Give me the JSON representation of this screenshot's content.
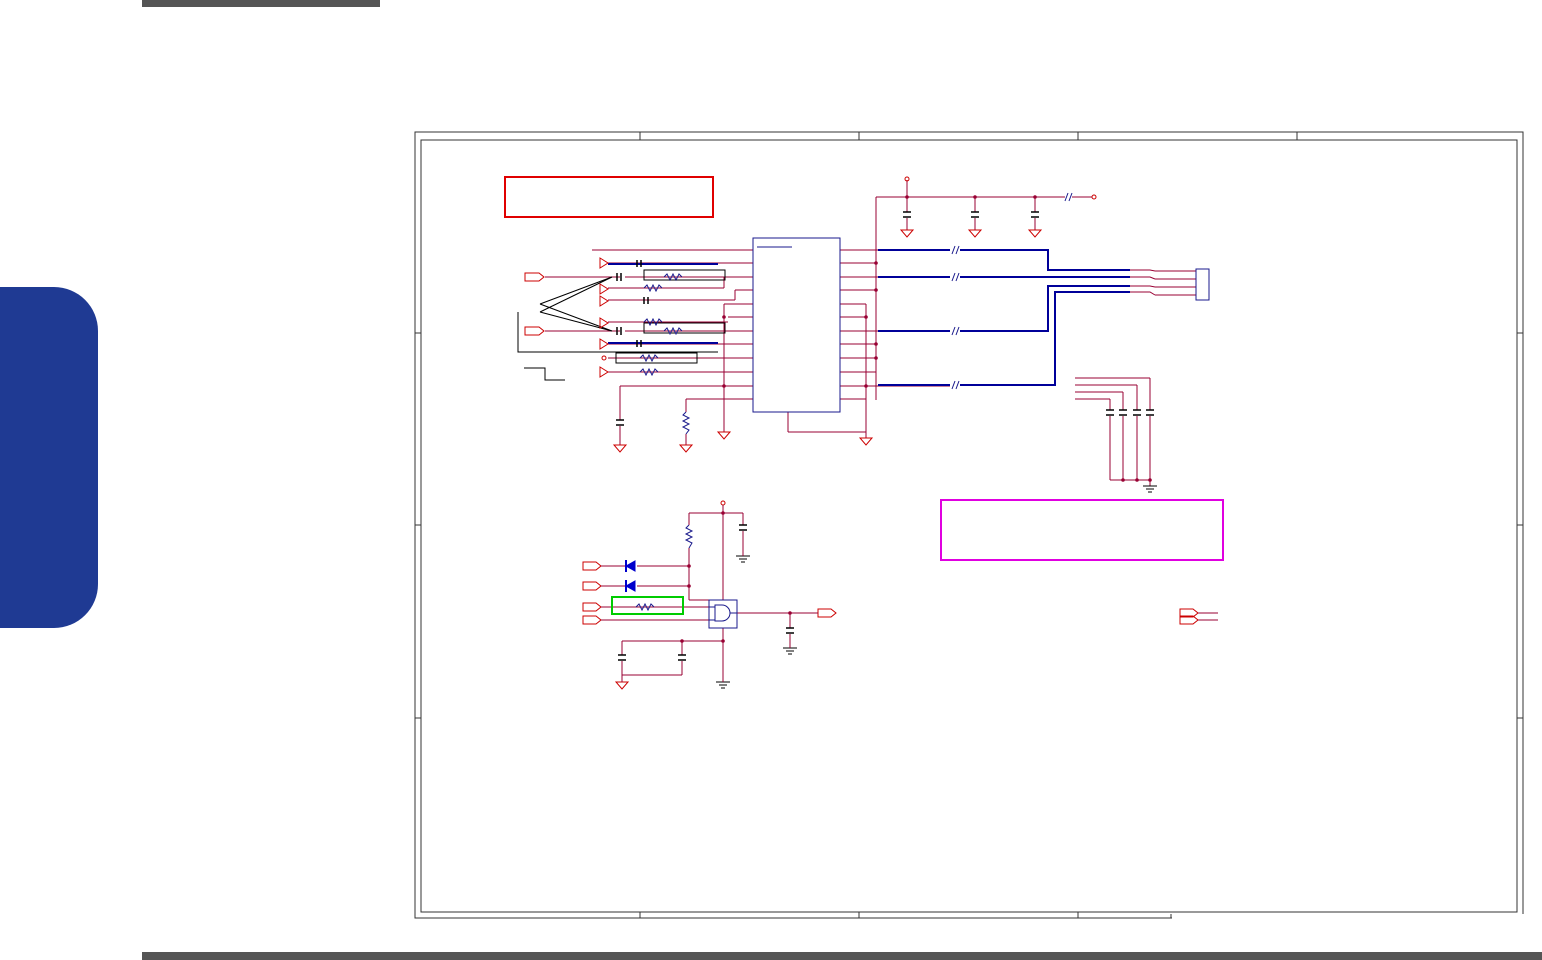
{
  "page": {
    "has_top_rule": true,
    "has_bottom_rule": true,
    "has_side_tab": true
  },
  "colors": {
    "frame": "#333333",
    "wire": "#990033",
    "power_symbol": "#cc0000",
    "chip_outline": "#1a1a8c",
    "bus": "#000099",
    "diode": "#0000cc",
    "note_box_red": "#e00000",
    "note_box_magenta": "#e000e0",
    "highlight_green": "#00cc00",
    "side_tab": "#1f3a93",
    "rule": "#555555"
  },
  "schematic": {
    "frame_zones": "5x4",
    "note_boxes": [
      {
        "color": "red",
        "text": ""
      },
      {
        "color": "magenta",
        "text": ""
      }
    ],
    "highlight_boxes": [
      "green"
    ]
  }
}
